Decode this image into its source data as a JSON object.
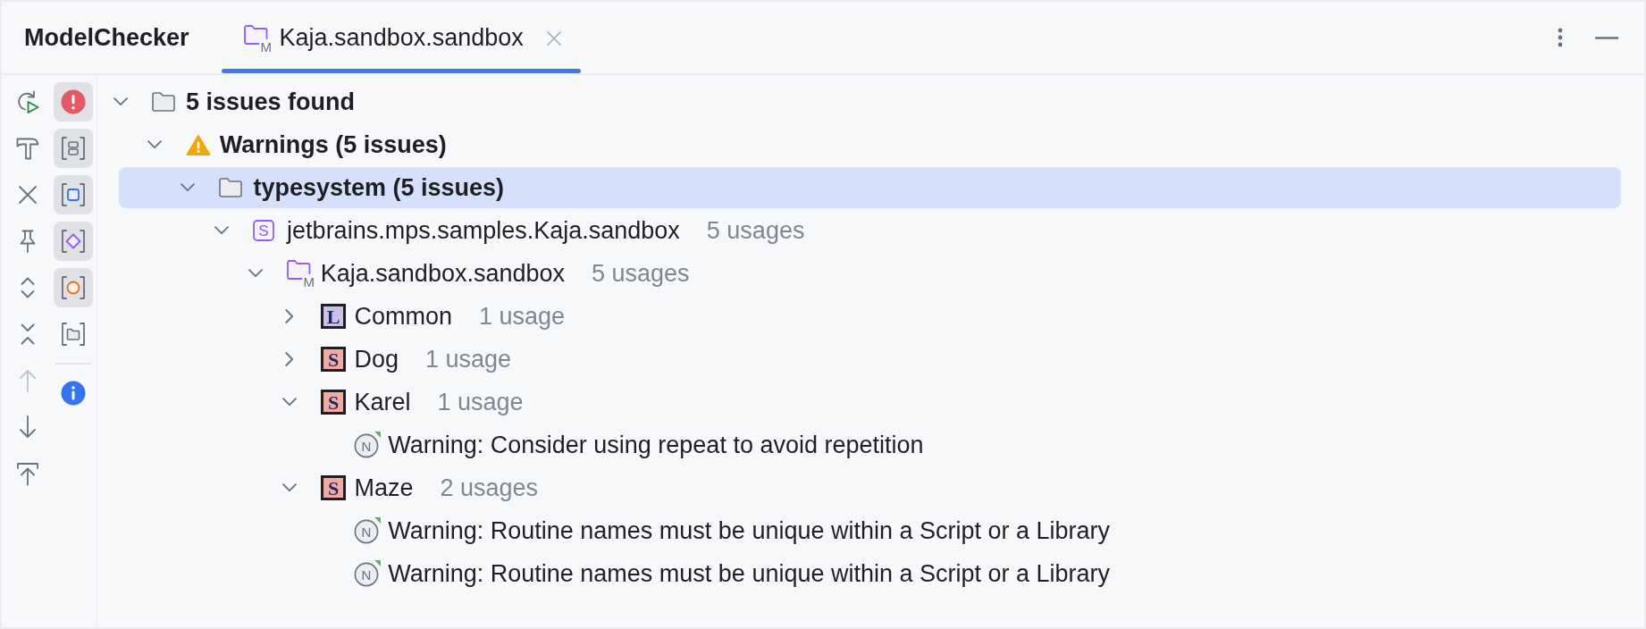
{
  "panel": {
    "title": "ModelChecker",
    "tabs": [
      {
        "label": "Kaja.sandbox.sandbox",
        "kind": "model",
        "badge": "M",
        "selected": true,
        "closable": true
      }
    ]
  },
  "toolbar": {
    "actions": [
      {
        "kind": "rerun",
        "disabled": false
      },
      {
        "kind": "build",
        "disabled": false
      },
      {
        "kind": "close",
        "disabled": false
      },
      {
        "kind": "pin",
        "disabled": false
      },
      {
        "kind": "expand",
        "disabled": false
      },
      {
        "kind": "collapse",
        "disabled": false
      },
      {
        "kind": "previous",
        "disabled": true
      },
      {
        "kind": "next",
        "disabled": false
      },
      {
        "kind": "export",
        "disabled": false
      }
    ],
    "filter_groups": [
      {
        "items": [
          {
            "kind": "error",
            "on": true
          },
          {
            "kind": "boxes",
            "on": true
          },
          {
            "kind": "square",
            "on": true
          },
          {
            "kind": "diamond",
            "on": true
          },
          {
            "kind": "circle",
            "on": true
          },
          {
            "kind": "folder",
            "on": false
          }
        ]
      },
      {
        "items": [
          {
            "kind": "info",
            "on": false
          }
        ]
      }
    ]
  },
  "tree": [
    {
      "label": "5 issues found",
      "kind": "summary",
      "expanded": true,
      "selected": false,
      "children": [
        {
          "label": "Warnings (5 issues)",
          "kind": "severity",
          "expanded": true,
          "selected": false,
          "children": [
            {
              "label": "typesystem (5 issues)",
              "kind": "category",
              "expanded": true,
              "selected": true,
              "children": [
                {
                  "label": "jetbrains.mps.samples.Kaja.sandbox",
                  "usages": "5 usages",
                  "kind": "module",
                  "badge": "S",
                  "expanded": true,
                  "selected": false,
                  "children": [
                    {
                      "label": "Kaja.sandbox.sandbox",
                      "usages": "5 usages",
                      "kind": "model",
                      "badge": "M",
                      "expanded": true,
                      "selected": false,
                      "children": [
                        {
                          "label": "Common",
                          "usages": "1 usage",
                          "kind": "root",
                          "badge": "L",
                          "color": "#cdbfe6",
                          "expanded": false,
                          "selected": false
                        },
                        {
                          "label": "Dog",
                          "usages": "1 usage",
                          "kind": "root",
                          "badge": "S",
                          "color": "#f2a9a1",
                          "expanded": false,
                          "selected": false
                        },
                        {
                          "label": "Karel",
                          "usages": "1 usage",
                          "kind": "root",
                          "badge": "S",
                          "color": "#f2a9a1",
                          "expanded": true,
                          "selected": false,
                          "children": [
                            {
                              "label": "Warning: Consider using repeat to avoid repetition",
                              "kind": "message",
                              "badge": "N",
                              "selected": false
                            }
                          ]
                        },
                        {
                          "label": "Maze",
                          "usages": "2 usages",
                          "kind": "root",
                          "badge": "S",
                          "color": "#f2a9a1",
                          "expanded": true,
                          "selected": false,
                          "children": [
                            {
                              "label": "Warning: Routine names must be unique within a Script or a Library",
                              "kind": "message",
                              "badge": "N",
                              "selected": false
                            },
                            {
                              "label": "Warning: Routine names must be unique within a Script or a Library",
                              "kind": "message",
                              "badge": "N",
                              "selected": false
                            }
                          ]
                        }
                      ]
                    }
                  ]
                }
              ]
            }
          ]
        }
      ]
    }
  ]
}
